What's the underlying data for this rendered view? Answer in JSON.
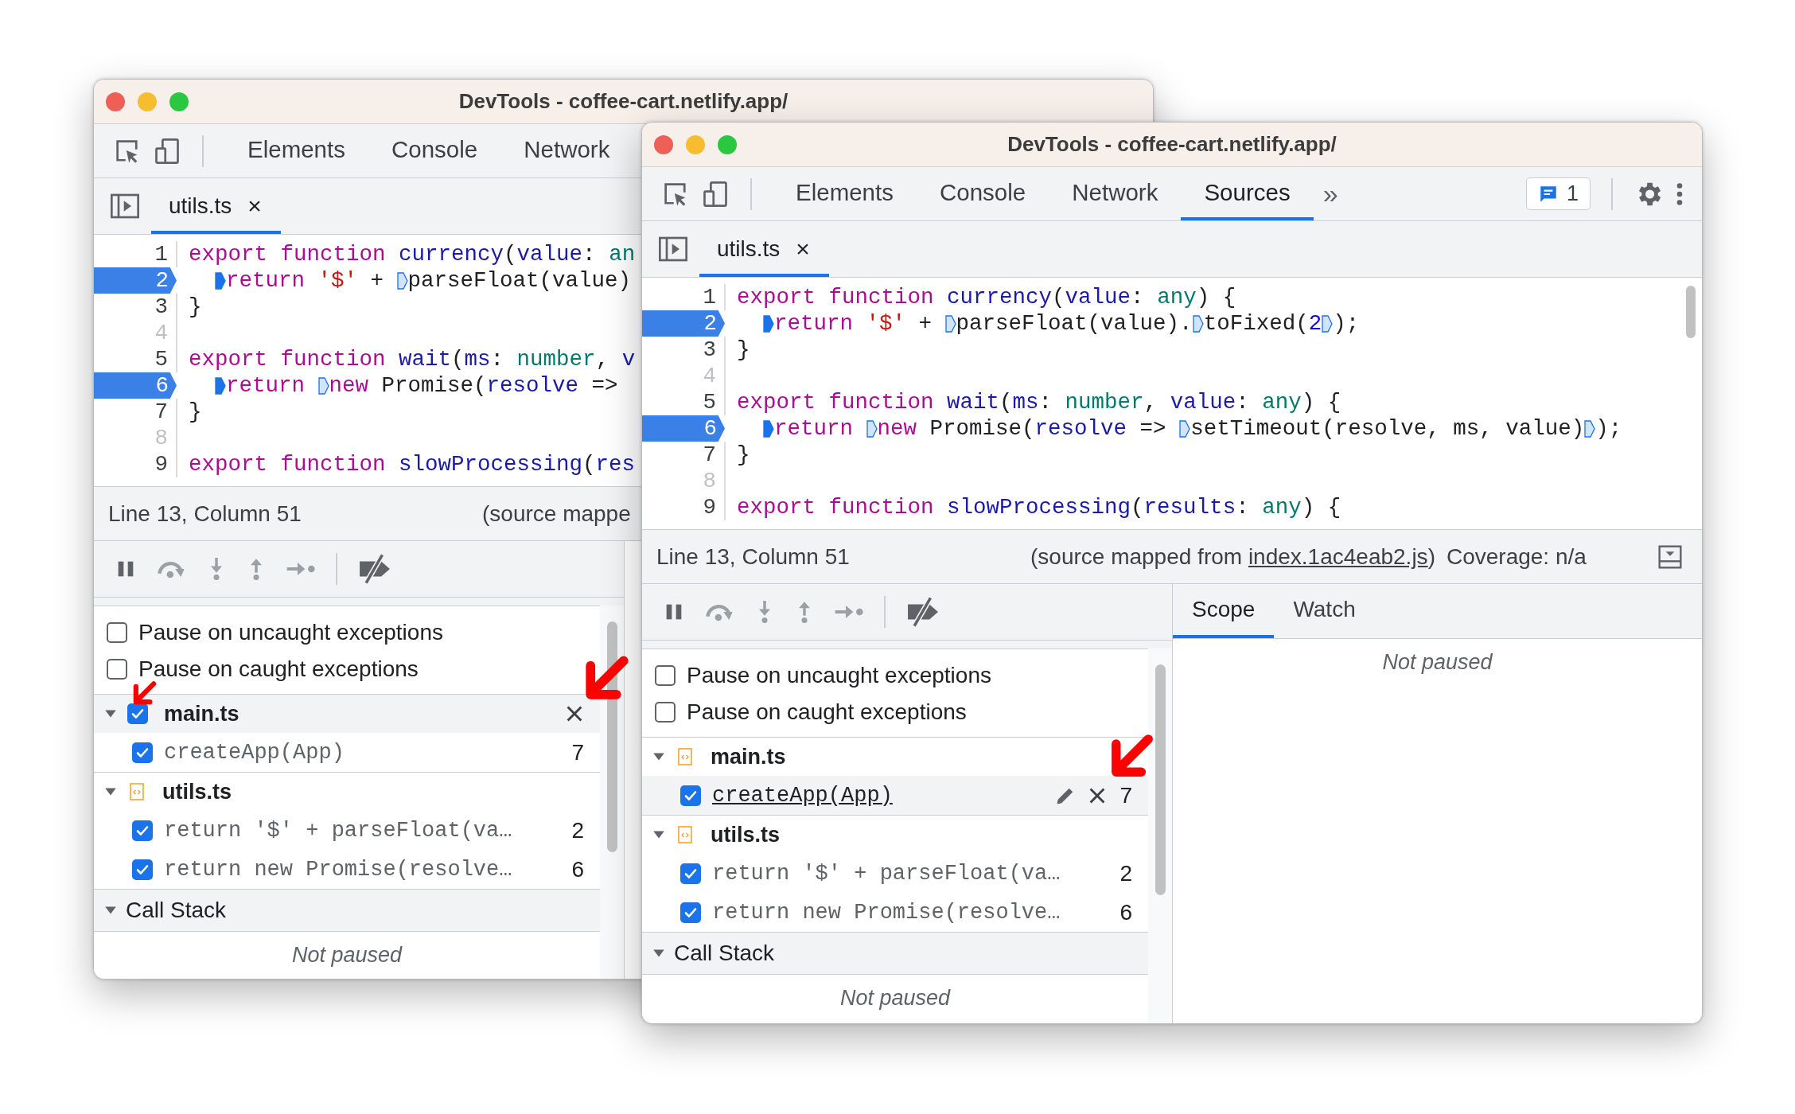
{
  "windows": [
    {
      "title": "DevTools - coffee-cart.netlify.app/",
      "tabs": [
        {
          "label": "Elements",
          "selected": false
        },
        {
          "label": "Console",
          "selected": false
        },
        {
          "label": "Network",
          "selected": false
        }
      ],
      "file_tab": {
        "label": "utils.ts",
        "close": "×",
        "selected": true
      },
      "code": [
        {
          "num": "1",
          "breakpoint": false,
          "disabled": false,
          "indented": false,
          "tokens": [
            {
              "kind": "keyword",
              "text": "export function "
            },
            {
              "kind": "name",
              "text": "currency"
            },
            {
              "kind": "plain",
              "text": "("
            },
            {
              "kind": "name",
              "text": "value"
            },
            {
              "kind": "plain",
              "text": ": "
            },
            {
              "kind": "type",
              "text": "an"
            }
          ]
        },
        {
          "num": "2",
          "breakpoint": true,
          "disabled": false,
          "indented": true,
          "tokens": [
            {
              "kind": "marker",
              "active": true
            },
            {
              "kind": "keyword",
              "text": "return "
            },
            {
              "kind": "string",
              "text": "'$'"
            },
            {
              "kind": "plain",
              "text": " + "
            },
            {
              "kind": "marker",
              "active": false
            },
            {
              "kind": "plain",
              "text": "parseFloat(value)"
            }
          ]
        },
        {
          "num": "3",
          "breakpoint": false,
          "disabled": false,
          "tokens": [
            {
              "kind": "plain",
              "text": "}"
            }
          ]
        },
        {
          "num": "4",
          "breakpoint": false,
          "disabled": true
        },
        {
          "num": "5",
          "breakpoint": false,
          "disabled": false,
          "tokens": [
            {
              "kind": "keyword",
              "text": "export function "
            },
            {
              "kind": "name",
              "text": "wait"
            },
            {
              "kind": "plain",
              "text": "("
            },
            {
              "kind": "name",
              "text": "ms"
            },
            {
              "kind": "plain",
              "text": ": "
            },
            {
              "kind": "type",
              "text": "number"
            },
            {
              "kind": "plain",
              "text": ", "
            },
            {
              "kind": "name",
              "text": "v"
            }
          ]
        },
        {
          "num": "6",
          "breakpoint": true,
          "disabled": false,
          "indented": true,
          "tokens": [
            {
              "kind": "marker",
              "active": true
            },
            {
              "kind": "keyword",
              "text": "return "
            },
            {
              "kind": "marker",
              "active": false
            },
            {
              "kind": "keyword",
              "text": "new"
            },
            {
              "kind": "plain",
              "text": " Promise("
            },
            {
              "kind": "name",
              "text": "resolve"
            },
            {
              "kind": "plain",
              "text": " =>"
            }
          ]
        },
        {
          "num": "7",
          "breakpoint": false,
          "disabled": false,
          "tokens": [
            {
              "kind": "plain",
              "text": "}"
            }
          ]
        },
        {
          "num": "8",
          "breakpoint": false,
          "disabled": true
        },
        {
          "num": "9",
          "breakpoint": false,
          "disabled": false,
          "tokens": [
            {
              "kind": "keyword",
              "text": "export function "
            },
            {
              "kind": "name",
              "text": "slowProcessing"
            },
            {
              "kind": "plain",
              "text": "("
            },
            {
              "kind": "name",
              "text": "res"
            }
          ]
        }
      ],
      "status": {
        "position": "Line 13, Column 51",
        "source": "(source mappe"
      },
      "breakpoints": {
        "options": [
          {
            "label": "Pause on uncaught exceptions",
            "checked": false
          },
          {
            "label": "Pause on caught exceptions",
            "checked": false
          }
        ],
        "groups": [
          {
            "file": "main.ts",
            "kind": "checkbox",
            "checked": true,
            "hovered": true,
            "expanded": true,
            "items": [
              {
                "code": "createApp(App)",
                "line": "7",
                "checked": true,
                "hovered": false
              }
            ]
          },
          {
            "file": "utils.ts",
            "kind": "file",
            "hovered": false,
            "expanded": true,
            "items": [
              {
                "code": "return '$' + parseFloat(va…",
                "line": "2",
                "checked": true,
                "hovered": false
              },
              {
                "code": "return new Promise(resolve…",
                "line": "6",
                "checked": true,
                "hovered": false
              }
            ]
          }
        ]
      },
      "call_stack": {
        "title": "Call Stack",
        "expanded": true,
        "message": "Not paused"
      }
    },
    {
      "title": "DevTools - coffee-cart.netlify.app/",
      "tabs": [
        {
          "label": "Elements",
          "selected": false
        },
        {
          "label": "Console",
          "selected": false
        },
        {
          "label": "Network",
          "selected": false
        },
        {
          "label": "Sources",
          "selected": true
        }
      ],
      "more_tabs": "»",
      "issues": "1",
      "file_tab": {
        "label": "utils.ts",
        "close": "×",
        "selected": true
      },
      "code": [
        {
          "num": "1",
          "breakpoint": false,
          "disabled": false,
          "indented": false,
          "tokens": [
            {
              "kind": "keyword",
              "text": "export function "
            },
            {
              "kind": "name",
              "text": "currency"
            },
            {
              "kind": "plain",
              "text": "("
            },
            {
              "kind": "name",
              "text": "value"
            },
            {
              "kind": "plain",
              "text": ": "
            },
            {
              "kind": "type",
              "text": "any"
            },
            {
              "kind": "plain",
              "text": ") {"
            }
          ]
        },
        {
          "num": "2",
          "breakpoint": true,
          "disabled": false,
          "indented": true,
          "tokens": [
            {
              "kind": "marker",
              "active": true
            },
            {
              "kind": "keyword",
              "text": "return "
            },
            {
              "kind": "string",
              "text": "'$'"
            },
            {
              "kind": "plain",
              "text": " + "
            },
            {
              "kind": "marker",
              "active": false
            },
            {
              "kind": "plain",
              "text": "parseFloat(value)."
            },
            {
              "kind": "marker",
              "active": false
            },
            {
              "kind": "plain",
              "text": "toFixed("
            },
            {
              "kind": "number",
              "text": "2"
            },
            {
              "kind": "marker",
              "active": false
            },
            {
              "kind": "plain",
              "text": ");"
            }
          ]
        },
        {
          "num": "3",
          "breakpoint": false,
          "disabled": false,
          "tokens": [
            {
              "kind": "plain",
              "text": "}"
            }
          ]
        },
        {
          "num": "4",
          "breakpoint": false,
          "disabled": true
        },
        {
          "num": "5",
          "breakpoint": false,
          "disabled": false,
          "tokens": [
            {
              "kind": "keyword",
              "text": "export function "
            },
            {
              "kind": "name",
              "text": "wait"
            },
            {
              "kind": "plain",
              "text": "("
            },
            {
              "kind": "name",
              "text": "ms"
            },
            {
              "kind": "plain",
              "text": ": "
            },
            {
              "kind": "type",
              "text": "number"
            },
            {
              "kind": "plain",
              "text": ", "
            },
            {
              "kind": "name",
              "text": "value"
            },
            {
              "kind": "plain",
              "text": ": "
            },
            {
              "kind": "type",
              "text": "any"
            },
            {
              "kind": "plain",
              "text": ") {"
            }
          ]
        },
        {
          "num": "6",
          "breakpoint": true,
          "disabled": false,
          "indented": true,
          "tokens": [
            {
              "kind": "marker",
              "active": true
            },
            {
              "kind": "keyword",
              "text": "return "
            },
            {
              "kind": "marker",
              "active": false
            },
            {
              "kind": "keyword",
              "text": "new"
            },
            {
              "kind": "plain",
              "text": " Promise("
            },
            {
              "kind": "name",
              "text": "resolve"
            },
            {
              "kind": "plain",
              "text": " => "
            },
            {
              "kind": "marker",
              "active": false
            },
            {
              "kind": "plain",
              "text": "setTimeout(resolve, ms, value)"
            },
            {
              "kind": "marker",
              "active": false
            },
            {
              "kind": "plain",
              "text": ");"
            }
          ]
        },
        {
          "num": "7",
          "breakpoint": false,
          "disabled": false,
          "tokens": [
            {
              "kind": "plain",
              "text": "}"
            }
          ]
        },
        {
          "num": "8",
          "breakpoint": false,
          "disabled": true
        },
        {
          "num": "9",
          "breakpoint": false,
          "disabled": false,
          "tokens": [
            {
              "kind": "keyword",
              "text": "export function "
            },
            {
              "kind": "name",
              "text": "slowProcessing"
            },
            {
              "kind": "plain",
              "text": "("
            },
            {
              "kind": "name",
              "text": "results"
            },
            {
              "kind": "plain",
              "text": ": "
            },
            {
              "kind": "type",
              "text": "any"
            },
            {
              "kind": "plain",
              "text": ") {"
            }
          ]
        }
      ],
      "status": {
        "position": "Line 13, Column 51",
        "source": "(source mapped from",
        "link": "index.1ac4eab2.js",
        "source_end": ")",
        "coverage": "Coverage: n/a"
      },
      "breakpoints": {
        "options": [
          {
            "label": "Pause on uncaught exceptions",
            "checked": false
          },
          {
            "label": "Pause on caught exceptions",
            "checked": false
          }
        ],
        "groups": [
          {
            "file": "main.ts",
            "kind": "file",
            "hovered": false,
            "expanded": true,
            "items": [
              {
                "code": "createApp(App)",
                "line": "7",
                "checked": true,
                "hovered": true
              }
            ]
          },
          {
            "file": "utils.ts",
            "kind": "file",
            "hovered": false,
            "expanded": true,
            "items": [
              {
                "code": "return '$' + parseFloat(va…",
                "line": "2",
                "checked": true,
                "hovered": false
              },
              {
                "code": "return new Promise(resolve…",
                "line": "6",
                "checked": true,
                "hovered": false
              }
            ]
          }
        ]
      },
      "call_stack": {
        "title": "Call Stack",
        "expanded": true,
        "message": "Not paused"
      },
      "sidebar": {
        "tabs": [
          {
            "label": "Scope",
            "selected": true
          },
          {
            "label": "Watch",
            "selected": false
          }
        ],
        "message": "Not paused"
      }
    }
  ]
}
